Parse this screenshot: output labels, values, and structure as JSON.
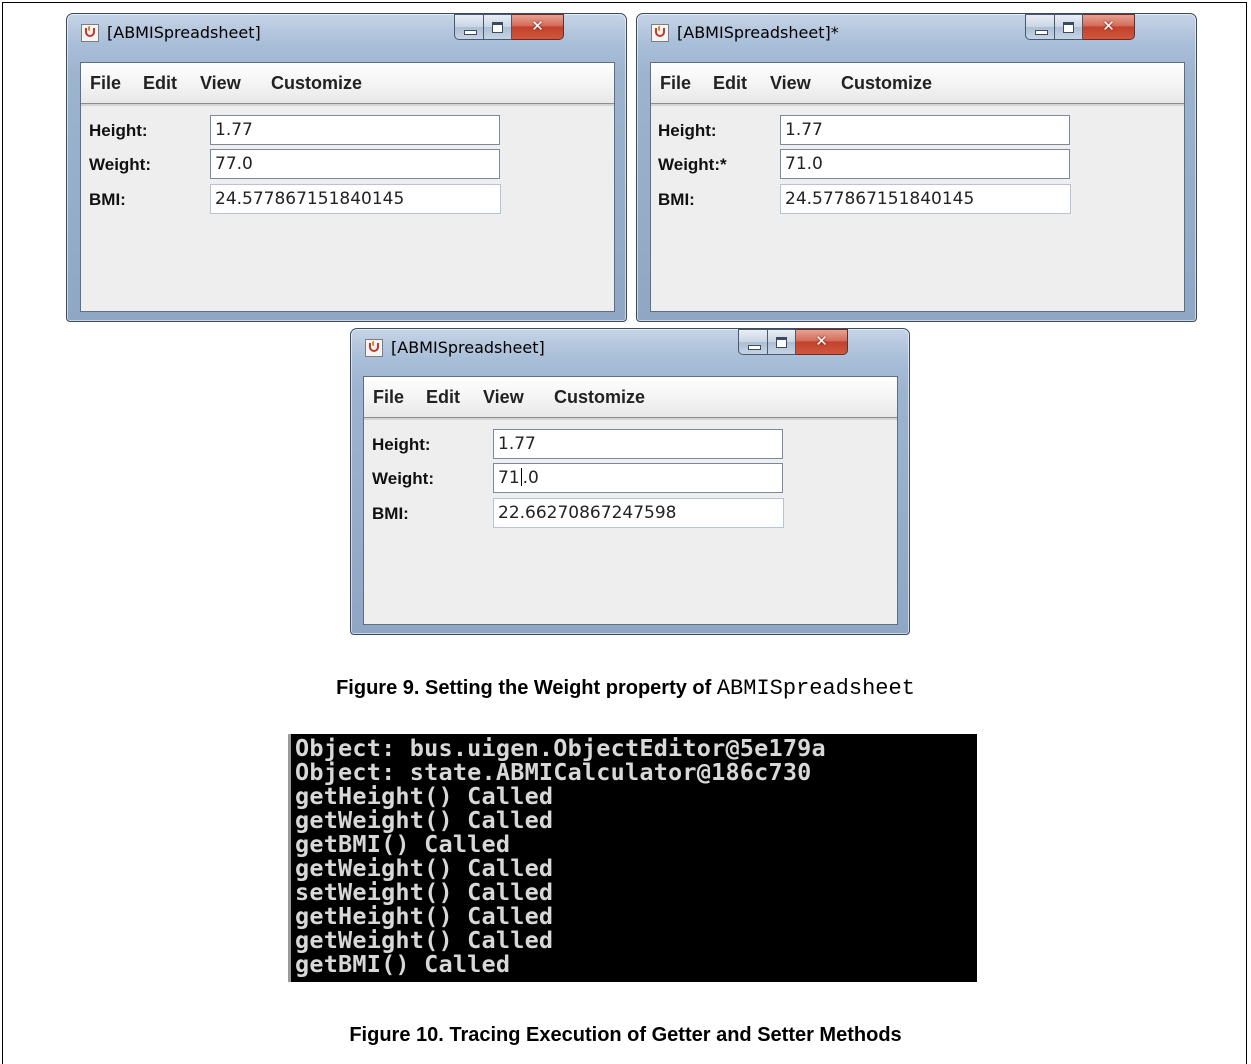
{
  "windows": [
    {
      "title": "[ABMISpreadsheet]",
      "menu": [
        "File",
        "Edit",
        "View",
        "Customize"
      ],
      "fields": [
        {
          "label": "Height:",
          "value": "1.77"
        },
        {
          "label": "Weight:",
          "value": "77.0"
        },
        {
          "label": "BMI:",
          "value": "24.577867151840145"
        }
      ]
    },
    {
      "title": "[ABMISpreadsheet]*",
      "menu": [
        "File",
        "Edit",
        "View",
        "Customize"
      ],
      "fields": [
        {
          "label": "Height:",
          "value": "1.77"
        },
        {
          "label": "Weight:*",
          "value": "71.0"
        },
        {
          "label": "BMI:",
          "value": "24.577867151840145"
        }
      ]
    },
    {
      "title": "[ABMISpreadsheet]",
      "menu": [
        "File",
        "Edit",
        "View",
        "Customize"
      ],
      "fields": [
        {
          "label": "Height:",
          "value": "1.77"
        },
        {
          "label": "Weight:",
          "value_before_caret": "71",
          "value_after_caret": ".0"
        },
        {
          "label": "BMI:",
          "value": "22.66270867247598"
        }
      ]
    }
  ],
  "captions": {
    "figure9_bold": "Figure 9. Setting the Weight property of",
    "figure9_code": "ABMISpreadsheet",
    "figure10": "Figure 10. Tracing Execution of Getter and Setter Methods"
  },
  "console_lines": [
    "Object: bus.uigen.ObjectEditor@5e179a",
    "Object: state.ABMICalculator@186c730",
    "getHeight() Called",
    "getWeight() Called",
    "getBMI() Called",
    "getWeight() Called",
    "setWeight() Called",
    "getHeight() Called",
    "getWeight() Called",
    "getBMI() Called"
  ],
  "icons": [
    "java-app-icon",
    "minimize-icon",
    "maximize-icon",
    "close-icon"
  ],
  "colors": {
    "title_bar": "#a9bed8",
    "close_button": "#c2412a",
    "console_background": "#000000",
    "console_text": "#d8d8d8"
  }
}
